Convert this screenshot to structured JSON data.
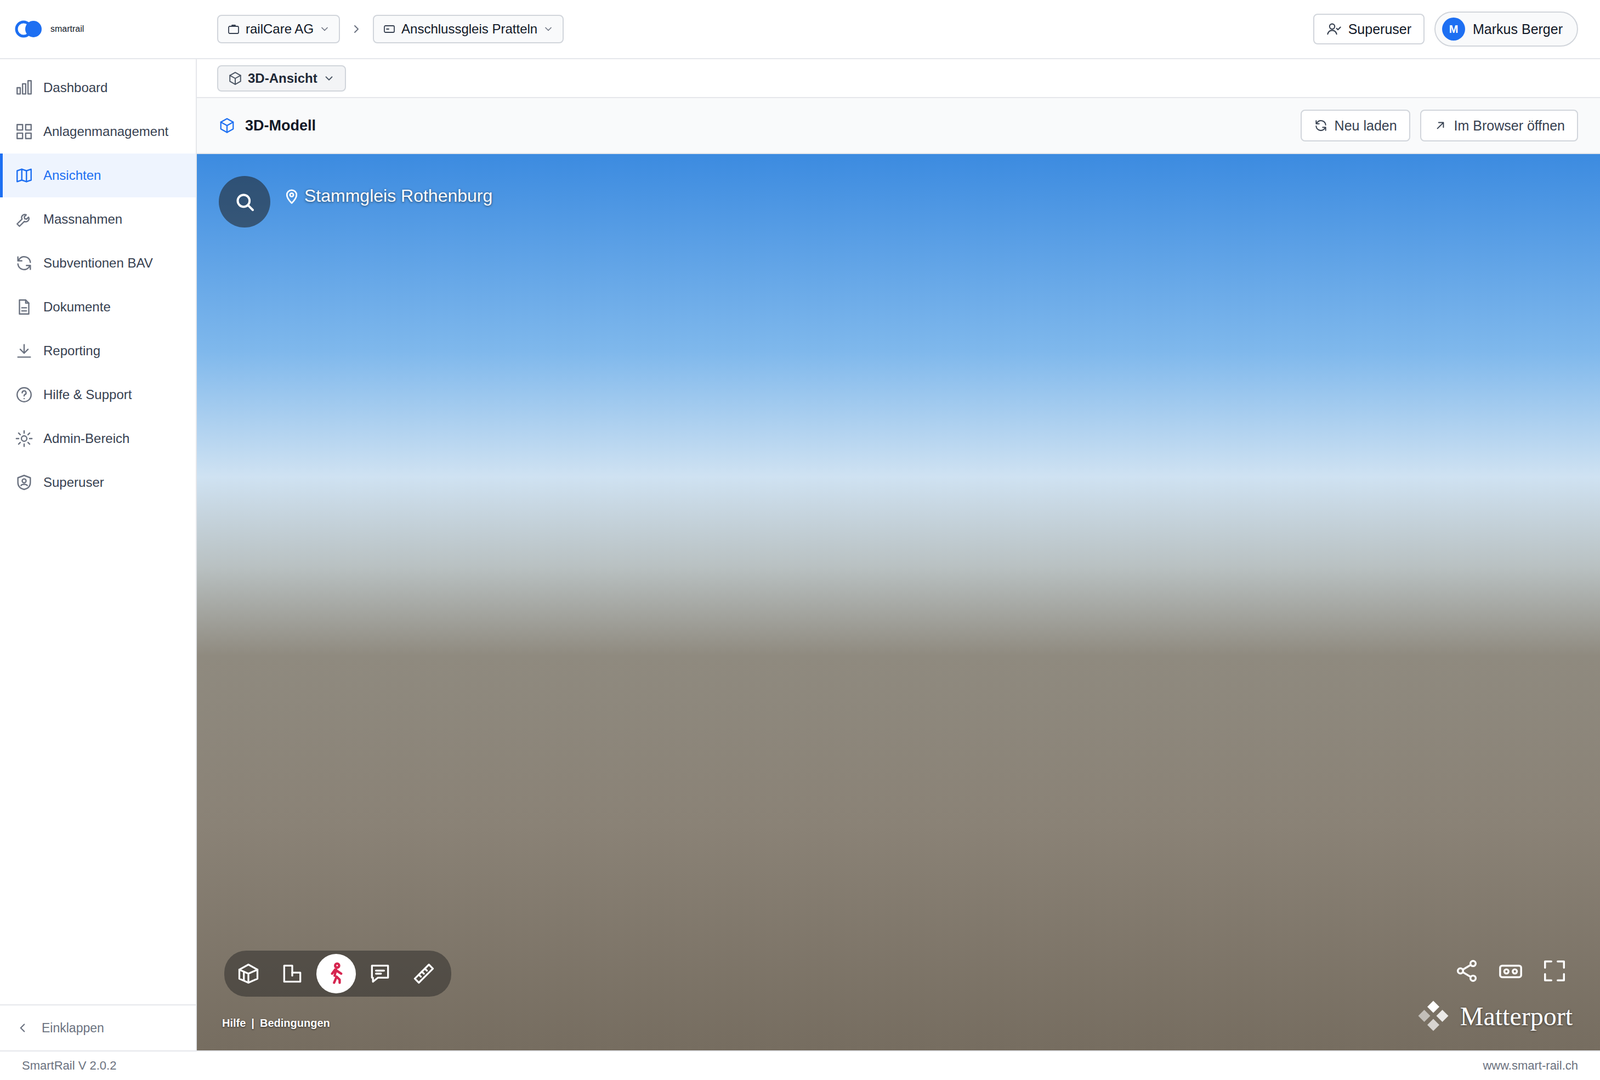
{
  "logo": {
    "text": "smartrail"
  },
  "breadcrumb": [
    {
      "label": "railCare AG"
    },
    {
      "label": "Anschlussgleis Pratteln"
    }
  ],
  "header": {
    "superuser_button": "Superuser",
    "user": {
      "initial": "M",
      "name": "Markus Berger"
    }
  },
  "sidebar": {
    "items": [
      {
        "label": "Dashboard",
        "selected": false
      },
      {
        "label": "Anlagenmanagement",
        "selected": false
      },
      {
        "label": "Ansichten",
        "selected": true
      },
      {
        "label": "Massnahmen",
        "selected": false
      },
      {
        "label": "Subventionen BAV",
        "selected": false
      },
      {
        "label": "Dokumente",
        "selected": false
      },
      {
        "label": "Reporting",
        "selected": false
      },
      {
        "label": "Hilfe & Support",
        "selected": false
      },
      {
        "label": "Admin-Bereich",
        "selected": false
      },
      {
        "label": "Superuser",
        "selected": false
      }
    ],
    "collapse": "Einklappen"
  },
  "view_select": {
    "label": "3D-Ansicht"
  },
  "panel": {
    "title": "3D-Modell",
    "buttons": [
      "Neu laden",
      "Im Browser öffnen"
    ]
  },
  "viewer": {
    "location": "Stammgleis Rothenburg",
    "tools": [
      {
        "selected": false
      },
      {
        "selected": false
      },
      {
        "selected": true
      },
      {
        "selected": false
      },
      {
        "selected": false
      }
    ],
    "links": [
      "Hilfe",
      "Bedingungen"
    ],
    "links_separator": "|",
    "brand": "Matterport"
  },
  "footer": {
    "version": "SmartRail V 2.0.2",
    "url": "www.smart-rail.ch"
  }
}
